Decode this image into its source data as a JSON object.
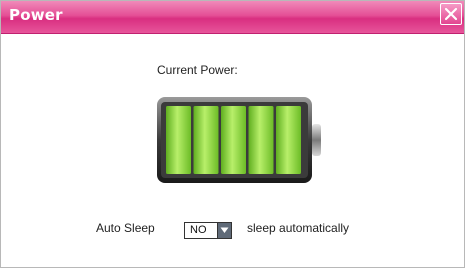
{
  "window": {
    "title": "Power",
    "accent_color": "#e54f96",
    "close_icon": "close-x-icon"
  },
  "power": {
    "current_label": "Current Power:",
    "battery_icon": "battery-icon",
    "battery_level_fraction": 1.0,
    "battery_segments_filled": 5,
    "battery_segments_total": 5,
    "battery_fill_color": "#8fd43a"
  },
  "auto_sleep": {
    "label": "Auto Sleep",
    "selected_value": "NO",
    "description": "sleep automatically",
    "dropdown_icon": "chevron-down-icon"
  }
}
